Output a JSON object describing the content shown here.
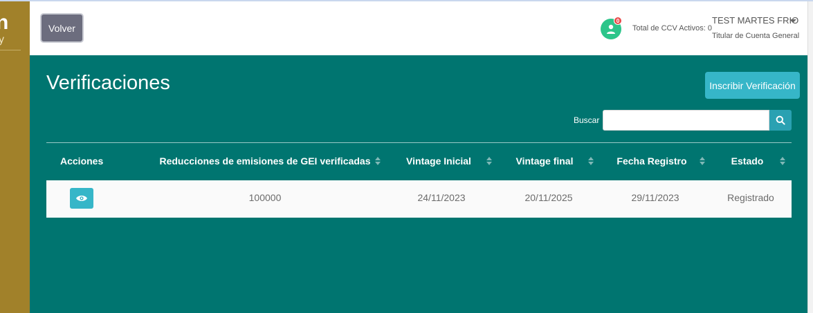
{
  "sidebar": {
    "logo_fragment": "n",
    "sub_fragment": "y"
  },
  "header": {
    "back_label": "Volver",
    "notification_count": "0",
    "ccv_total": "Total de CCV Activos: 0",
    "user_name": "TEST MARTES FRIO",
    "user_role": "Titular de Cuenta General"
  },
  "main": {
    "title": "Verificaciones",
    "new_button": "Inscribir Verificación",
    "search_label": "Buscar",
    "search_value": ""
  },
  "table": {
    "columns": [
      "Acciones",
      "Reducciones de emisiones de GEI verificadas",
      "Vintage Inicial",
      "Vintage final",
      "Fecha Registro",
      "Estado"
    ],
    "rows": [
      {
        "reducciones": "100000",
        "vintage_inicial": "24/11/2023",
        "vintage_final": "20/11/2025",
        "fecha_registro": "29/11/2023",
        "estado": "Registrado"
      }
    ]
  },
  "colors": {
    "sidebar": "#a1812a",
    "main_bg": "#007570",
    "accent": "#36b6c8",
    "avatar": "#2cc58a",
    "badge": "#e84a4a"
  },
  "icons": {
    "avatar": "user-icon",
    "search": "search-icon",
    "view": "eye-icon",
    "sort": "sort-icon",
    "dropdown": "caret-down-icon"
  }
}
